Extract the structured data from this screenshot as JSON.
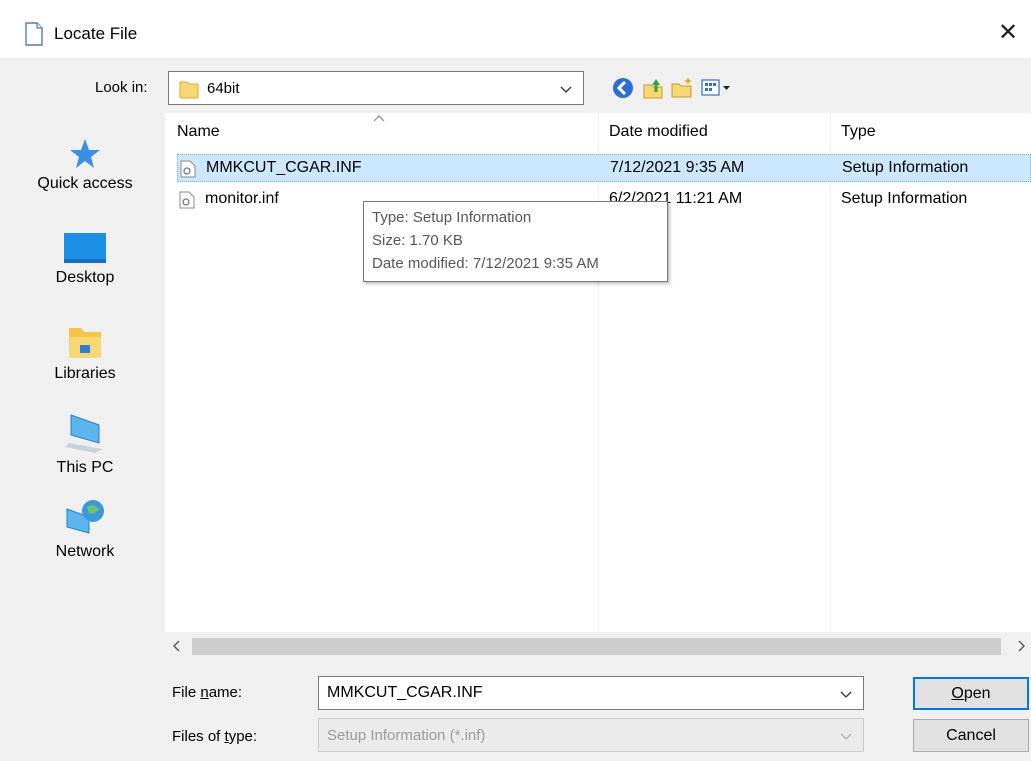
{
  "window": {
    "title": "Locate File",
    "close_glyph": "✕"
  },
  "lookin": {
    "label": "Look in:",
    "value": "64bit"
  },
  "toolbar": {
    "icons": [
      "back-icon",
      "up-folder-icon",
      "new-folder-icon",
      "view-menu-icon"
    ]
  },
  "sidebar": {
    "items": [
      {
        "label": "Quick access",
        "icon": "star-icon"
      },
      {
        "label": "Desktop",
        "icon": "desktop-icon"
      },
      {
        "label": "Libraries",
        "icon": "libraries-icon"
      },
      {
        "label": "This PC",
        "icon": "computer-icon"
      },
      {
        "label": "Network",
        "icon": "network-icon"
      }
    ]
  },
  "filelist": {
    "columns": [
      "Name",
      "Date modified",
      "Type"
    ],
    "rows": [
      {
        "name": "MMKCUT_CGAR.INF",
        "date": "7/12/2021 9:35 AM",
        "type": "Setup Information",
        "selected": true
      },
      {
        "name": "monitor.inf",
        "date": "6/2/2021 11:21 AM",
        "type": "Setup Information",
        "selected": false
      }
    ]
  },
  "tooltip": {
    "type": "Type: Setup Information",
    "size": "Size: 1.70 KB",
    "date": "Date modified: 7/12/2021 9:35 AM"
  },
  "filename": {
    "label_pre": "File ",
    "label_u": "n",
    "label_post": "ame:",
    "value": "MMKCUT_CGAR.INF"
  },
  "filetype": {
    "label_pre": "Files of ",
    "label_u": "t",
    "label_post": "ype:",
    "value": "Setup Information (*.inf)"
  },
  "buttons": {
    "open_u": "O",
    "open_rest": "pen",
    "cancel": "Cancel"
  },
  "colors": {
    "accent": "#0078d7",
    "selection": "#cce8ff",
    "folder": "#f8d775"
  }
}
